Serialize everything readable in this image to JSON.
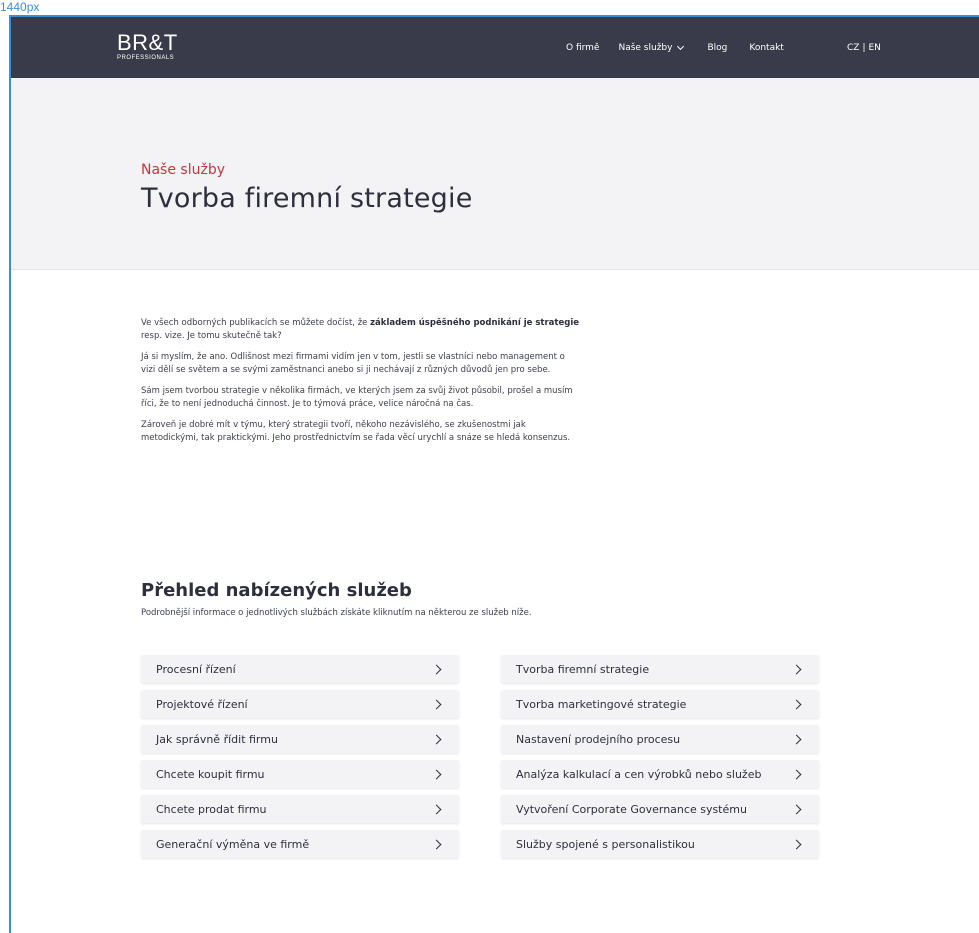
{
  "frame": {
    "label": "1440px"
  },
  "header": {
    "logo_main": "BR&T",
    "logo_sub": "PROFESSIONALS",
    "nav": [
      "O firmě",
      "Naše služby",
      "Blog",
      "Kontakt"
    ],
    "lang": [
      "CZ",
      "|",
      "EN"
    ]
  },
  "hero": {
    "kicker": "Naše služby",
    "title": "Tvorba firemní strategie"
  },
  "intro": {
    "p1_before": "Ve všech odborných publikacích se můžete dočíst, že ",
    "p1_bold": "základem úspěšného podnikání je strategie",
    "p1_after": " resp. vize. Je tomu skutečně tak?",
    "p2": "Já si myslím, že ano. Odlišnost mezi firmami vidím jen v tom, jestli se vlastníci nebo management o vizi dělí se světem a se svými zaměstnanci anebo si ji nechávají z různých důvodů jen pro sebe.",
    "p3": "Sám jsem tvorbou strategie v několika firmách, ve kterých jsem za svůj život působil, prošel a musím říci, že to není jednoduchá činnost. Je to týmová práce, velice náročná na čas.",
    "p4": "Zároveň je dobré mít v týmu, který strategii tvoří, někoho nezávislého, se zkušenostmi jak metodickými, tak praktickými. Jeho prostřednictvím se řada věcí urychlí a snáze se hledá konsenzus."
  },
  "services": {
    "title": "Přehled nabízených služeb",
    "subtitle": "Podrobnější informace o jednotlivých službách získáte kliknutím na některou ze služeb níže.",
    "left": [
      "Procesní řízení",
      "Projektové řízení",
      "Jak správně řídit firmu",
      "Chcete koupit firmu",
      "Chcete prodat firmu",
      "Generační výměna ve firmě"
    ],
    "right": [
      "Tvorba firemní strategie",
      "Tvorba marketingové strategie",
      "Nastavení prodejního procesu",
      "Analýza kalkulací a cen výrobků nebo služeb",
      "Vytvoření Corporate Governance systému",
      "Služby spojené s personalistikou"
    ]
  },
  "colors": {
    "navbar": "#3a3b4a",
    "accent": "#c0393f",
    "hero_bg": "#f3f3f5",
    "frame_guide": "#3b8fd9"
  },
  "icons": {
    "dropdown": "chevron-down-icon",
    "card_arrow": "chevron-right-icon"
  }
}
